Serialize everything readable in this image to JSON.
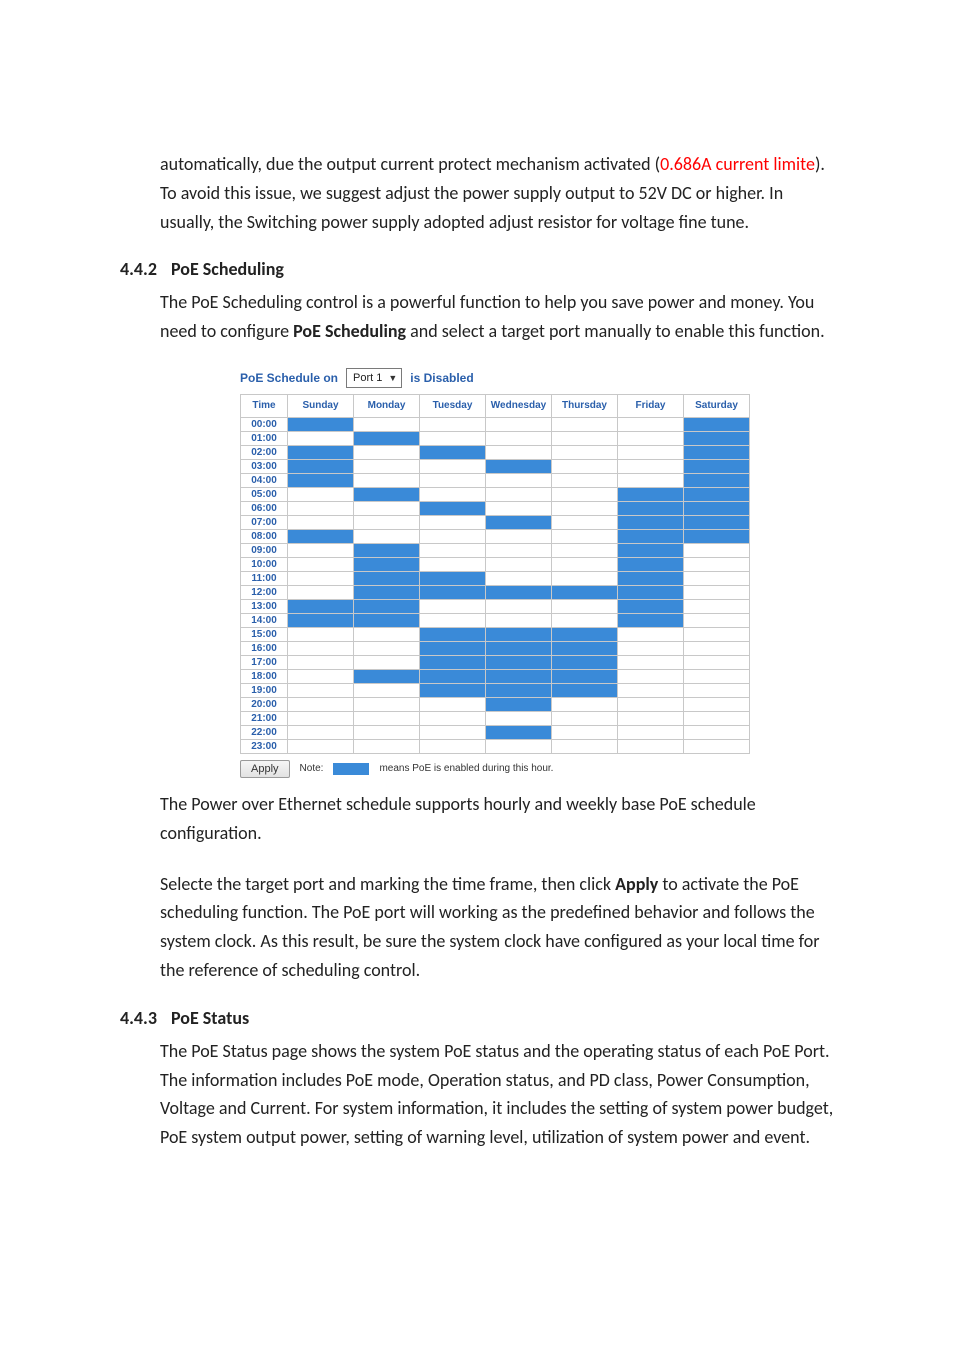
{
  "intro": {
    "pre": "automatically, due the output current protect mechanism activated (",
    "red": "0.686A current limite",
    "post": "). To avoid this issue, we suggest adjust the power supply output to 52V DC or higher. In usually, the Switching power supply adopted adjust resistor for voltage fine tune."
  },
  "sec442": {
    "num": "4.4.2",
    "title": "PoE Scheduling",
    "para_pre": "The PoE Scheduling control is a powerful function to help you save power and money. You need to configure ",
    "para_bold": "PoE Scheduling",
    "para_post": " and select a target port manually to enable this function.",
    "after1": "The Power over Ethernet schedule supports hourly and weekly base PoE schedule configuration.",
    "after2_pre": "Selecte the target port and marking the time frame, then click ",
    "after2_bold": "Apply",
    "after2_post": " to activate the PoE scheduling function. The PoE port will working as the predefined behavior and follows the system clock. As this result, be sure the system clock have configured as your local time for the reference of scheduling control."
  },
  "sec443": {
    "num": "4.4.3",
    "title": "PoE Status",
    "para": "The PoE Status page shows the system PoE status and the operating status of each PoE Port. The information includes PoE mode, Operation status, and PD class, Power Consumption, Voltage and Current. For system information, it includes the setting of system power budget, PoE system output power, setting of warning level, utilization of system power and event."
  },
  "schedule": {
    "title_prefix": "PoE Schedule on",
    "port_value": "Port 1",
    "title_suffix": "is  Disabled",
    "apply_label": "Apply",
    "note_label": "Note:",
    "note_text": "means PoE is enabled during this hour.",
    "columns": [
      "Time",
      "Sunday",
      "Monday",
      "Tuesday",
      "Wednesday",
      "Thursday",
      "Friday",
      "Saturday"
    ],
    "times": [
      "00:00",
      "01:00",
      "02:00",
      "03:00",
      "04:00",
      "05:00",
      "06:00",
      "07:00",
      "08:00",
      "09:00",
      "10:00",
      "11:00",
      "12:00",
      "13:00",
      "14:00",
      "15:00",
      "16:00",
      "17:00",
      "18:00",
      "19:00",
      "20:00",
      "21:00",
      "22:00",
      "23:00"
    ],
    "enabled": {
      "Sunday": [
        0,
        2,
        3,
        4,
        8,
        13,
        14
      ],
      "Monday": [
        1,
        5,
        9,
        10,
        11,
        12,
        13,
        14,
        18
      ],
      "Tuesday": [
        2,
        6,
        11,
        12,
        15,
        16,
        17,
        18,
        19
      ],
      "Wednesday": [
        3,
        7,
        12,
        15,
        16,
        17,
        18,
        19,
        20,
        22
      ],
      "Thursday": [
        12,
        15,
        16,
        17,
        18,
        19
      ],
      "Friday": [
        5,
        6,
        7,
        8,
        9,
        10,
        11,
        12,
        13,
        14
      ],
      "Saturday": [
        0,
        1,
        2,
        3,
        4,
        5,
        6,
        7,
        8
      ]
    }
  }
}
